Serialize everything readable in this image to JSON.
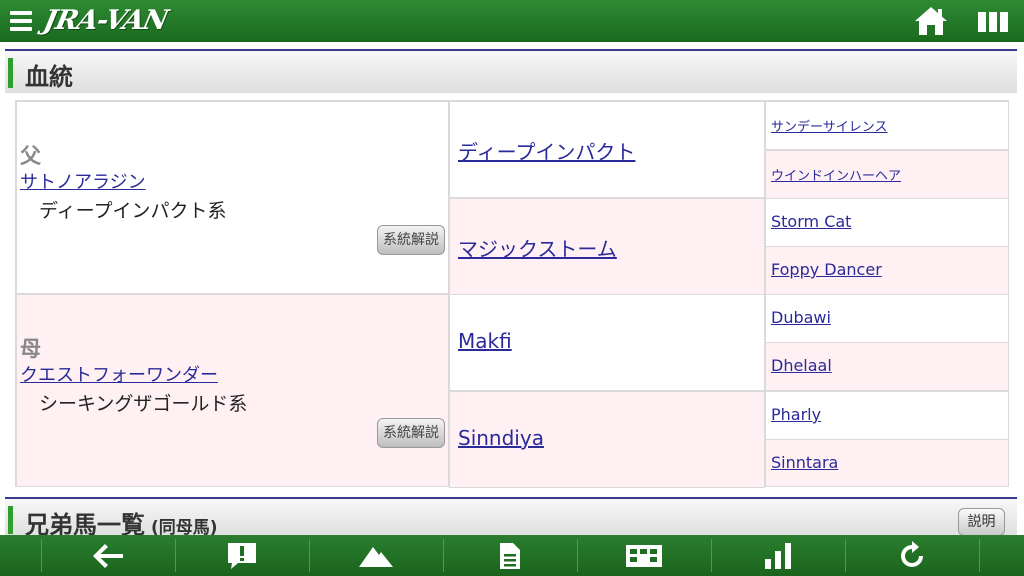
{
  "header": {
    "logo_text": "JRA-VAN"
  },
  "section_pedigree": {
    "title": "血統"
  },
  "pedigree": {
    "sire": {
      "role": "父",
      "name": "サトノアラジン",
      "lineage": "ディープインパクト系",
      "lineage_button": "系統解説",
      "sire": {
        "name": "ディープインパクト",
        "sire": "サンデーサイレンス",
        "dam": "ウインドインハーヘア"
      },
      "dam": {
        "name": "マジックストーム",
        "sire": "Storm Cat",
        "dam": "Foppy Dancer"
      }
    },
    "dam": {
      "role": "母",
      "name": "クエストフォーワンダー",
      "lineage": "シーキングザゴールド系",
      "lineage_button": "系統解説",
      "sire": {
        "name": "Makfi",
        "sire": "Dubawi",
        "dam": "Dhelaal"
      },
      "dam": {
        "name": "Sinndiya",
        "sire": "Pharly",
        "dam": "Sinntara"
      }
    }
  },
  "section_siblings": {
    "title": "兄弟馬一覧",
    "subtitle": "(同母馬)",
    "explain_button": "説明"
  },
  "icons": {
    "menu": "hamburger-menu-icon",
    "home": "home-icon",
    "columns": "columns-icon",
    "bottom": [
      "back-arrow-icon",
      "alert-icon",
      "mountain-icon",
      "document-icon",
      "schedule-icon",
      "bar-chart-icon",
      "refresh-icon"
    ]
  },
  "colors": {
    "brand_green": "#1a6a1e",
    "link": "#2a2a9a",
    "pink_row": "#fff0f3",
    "accent_bar": "#2ea02e"
  }
}
